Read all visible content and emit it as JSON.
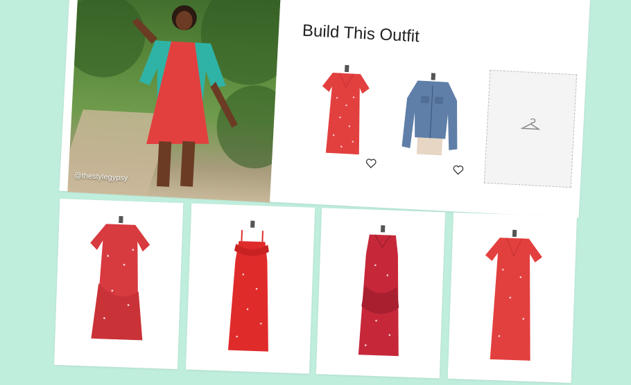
{
  "outfit": {
    "title": "Build This Outfit",
    "photo_credit": "@thestylegypsy",
    "items": [
      {
        "name": "Red polka dot wrap dress",
        "icon": "heart-outline-icon"
      },
      {
        "name": "Denim jacket",
        "icon": "heart-outline-icon"
      }
    ],
    "empty_slot_icon": "hanger-icon"
  },
  "similar_items": [
    {
      "name": "Red ruffle wrap dress"
    },
    {
      "name": "Red ruffle cami dress"
    },
    {
      "name": "Red sleeveless ruffle dress"
    },
    {
      "name": "Red dot wrap dress"
    }
  ],
  "colors": {
    "background": "#c0eedd",
    "dress_red": "#e2403f",
    "denim": "#5f7fa8"
  }
}
